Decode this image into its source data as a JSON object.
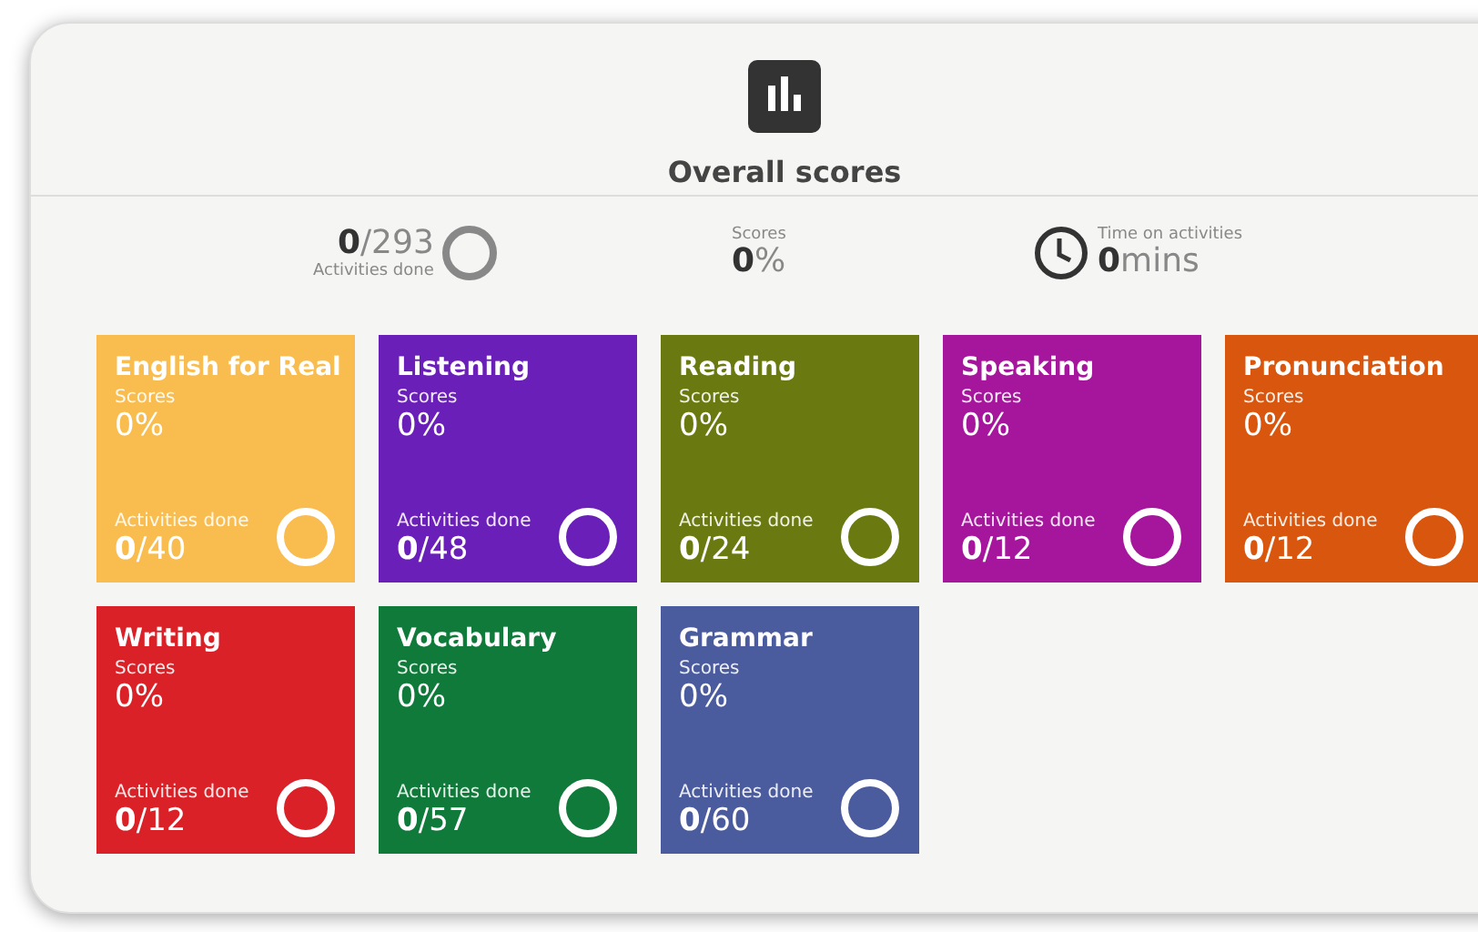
{
  "header": {
    "title": "Overall scores"
  },
  "summary": {
    "activities": "**0**/293",
    "activities_label": "Activities done",
    "scores_label": "Scores",
    "scores": "**0**%",
    "time_label": "Time on activities",
    "time": "**0**mins"
  },
  "tiles": [
    {
      "title": "English for Real",
      "color": "#f9bd4f",
      "scores_label": "Scores",
      "score": "0%",
      "activities_label": "Activities done",
      "activities": "**0**/40"
    },
    {
      "title": "Listening",
      "color": "#6a1fb8",
      "scores_label": "Scores",
      "score": "0%",
      "activities_label": "Activities done",
      "activities": "**0**/48"
    },
    {
      "title": "Reading",
      "color": "#6b7a10",
      "scores_label": "Scores",
      "score": "0%",
      "activities_label": "Activities done",
      "activities": "**0**/24"
    },
    {
      "title": "Speaking",
      "color": "#a5169c",
      "scores_label": "Scores",
      "score": "0%",
      "activities_label": "Activities done",
      "activities": "**0**/12"
    },
    {
      "title": "Pronunciation",
      "color": "#d9560e",
      "scores_label": "Scores",
      "score": "0%",
      "activities_label": "Activities done",
      "activities": "**0**/12"
    },
    {
      "title": "Writing",
      "color": "#da2127",
      "scores_label": "Scores",
      "score": "0%",
      "activities_label": "Activities done",
      "activities": "**0**/12"
    },
    {
      "title": "Vocabulary",
      "color": "#107a3a",
      "scores_label": "Scores",
      "score": "0%",
      "activities_label": "Activities done",
      "activities": "**0**/57"
    },
    {
      "title": "Grammar",
      "color": "#4a5b9e",
      "scores_label": "Scores",
      "score": "0%",
      "activities_label": "Activities done",
      "activities": "**0**/60"
    }
  ]
}
